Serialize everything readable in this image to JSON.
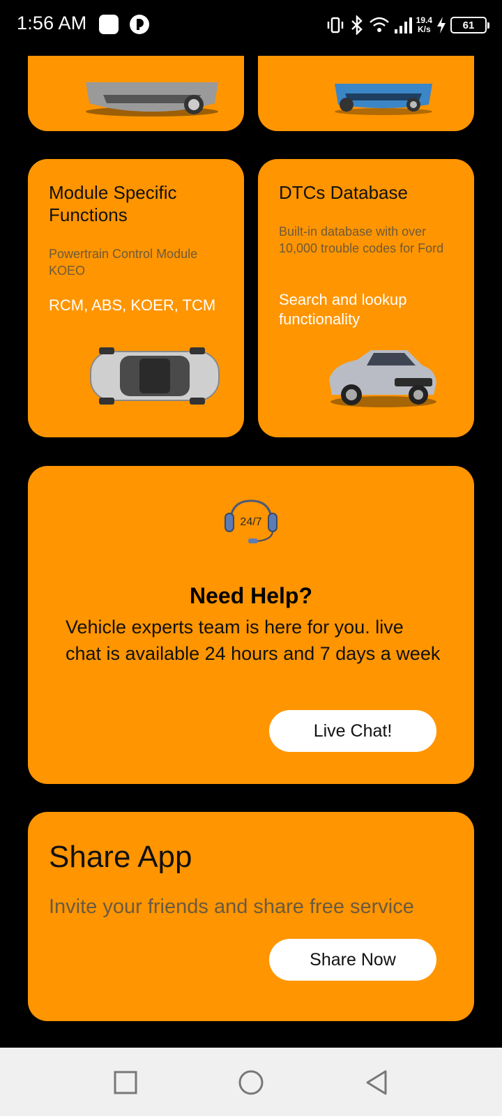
{
  "status_bar": {
    "time": "1:56 AM",
    "net_speed_value": "19.4",
    "net_speed_unit": "K/s",
    "battery": "61"
  },
  "top_cards": {
    "left_image": "silver-sedan-car",
    "right_image": "blue-hatchback-car"
  },
  "module_card": {
    "title": "Module Specific Functions",
    "subtitle": "Powertrain Control Module KOEO",
    "highlight": "RCM, ABS, KOER, TCM",
    "image": "top-view-car"
  },
  "dtc_card": {
    "title": "DTCs Database",
    "subtitle": "Built-in database with over 10,000 trouble codes for Ford",
    "highlight": "Search and lookup functionality",
    "image": "silver-mustang-car"
  },
  "help_card": {
    "icon": "headset-24-7-icon",
    "icon_text": "24/7",
    "title": "Need Help?",
    "body": "Vehicle experts team is here for you. live chat is available 24 hours and 7 days a week",
    "button": "Live Chat!"
  },
  "share_card": {
    "title": "Share App",
    "subtitle": "Invite your friends and share free service",
    "button": "Share Now"
  },
  "colors": {
    "card": "#FF9500",
    "background": "#000000",
    "button": "#FFFFFF"
  }
}
